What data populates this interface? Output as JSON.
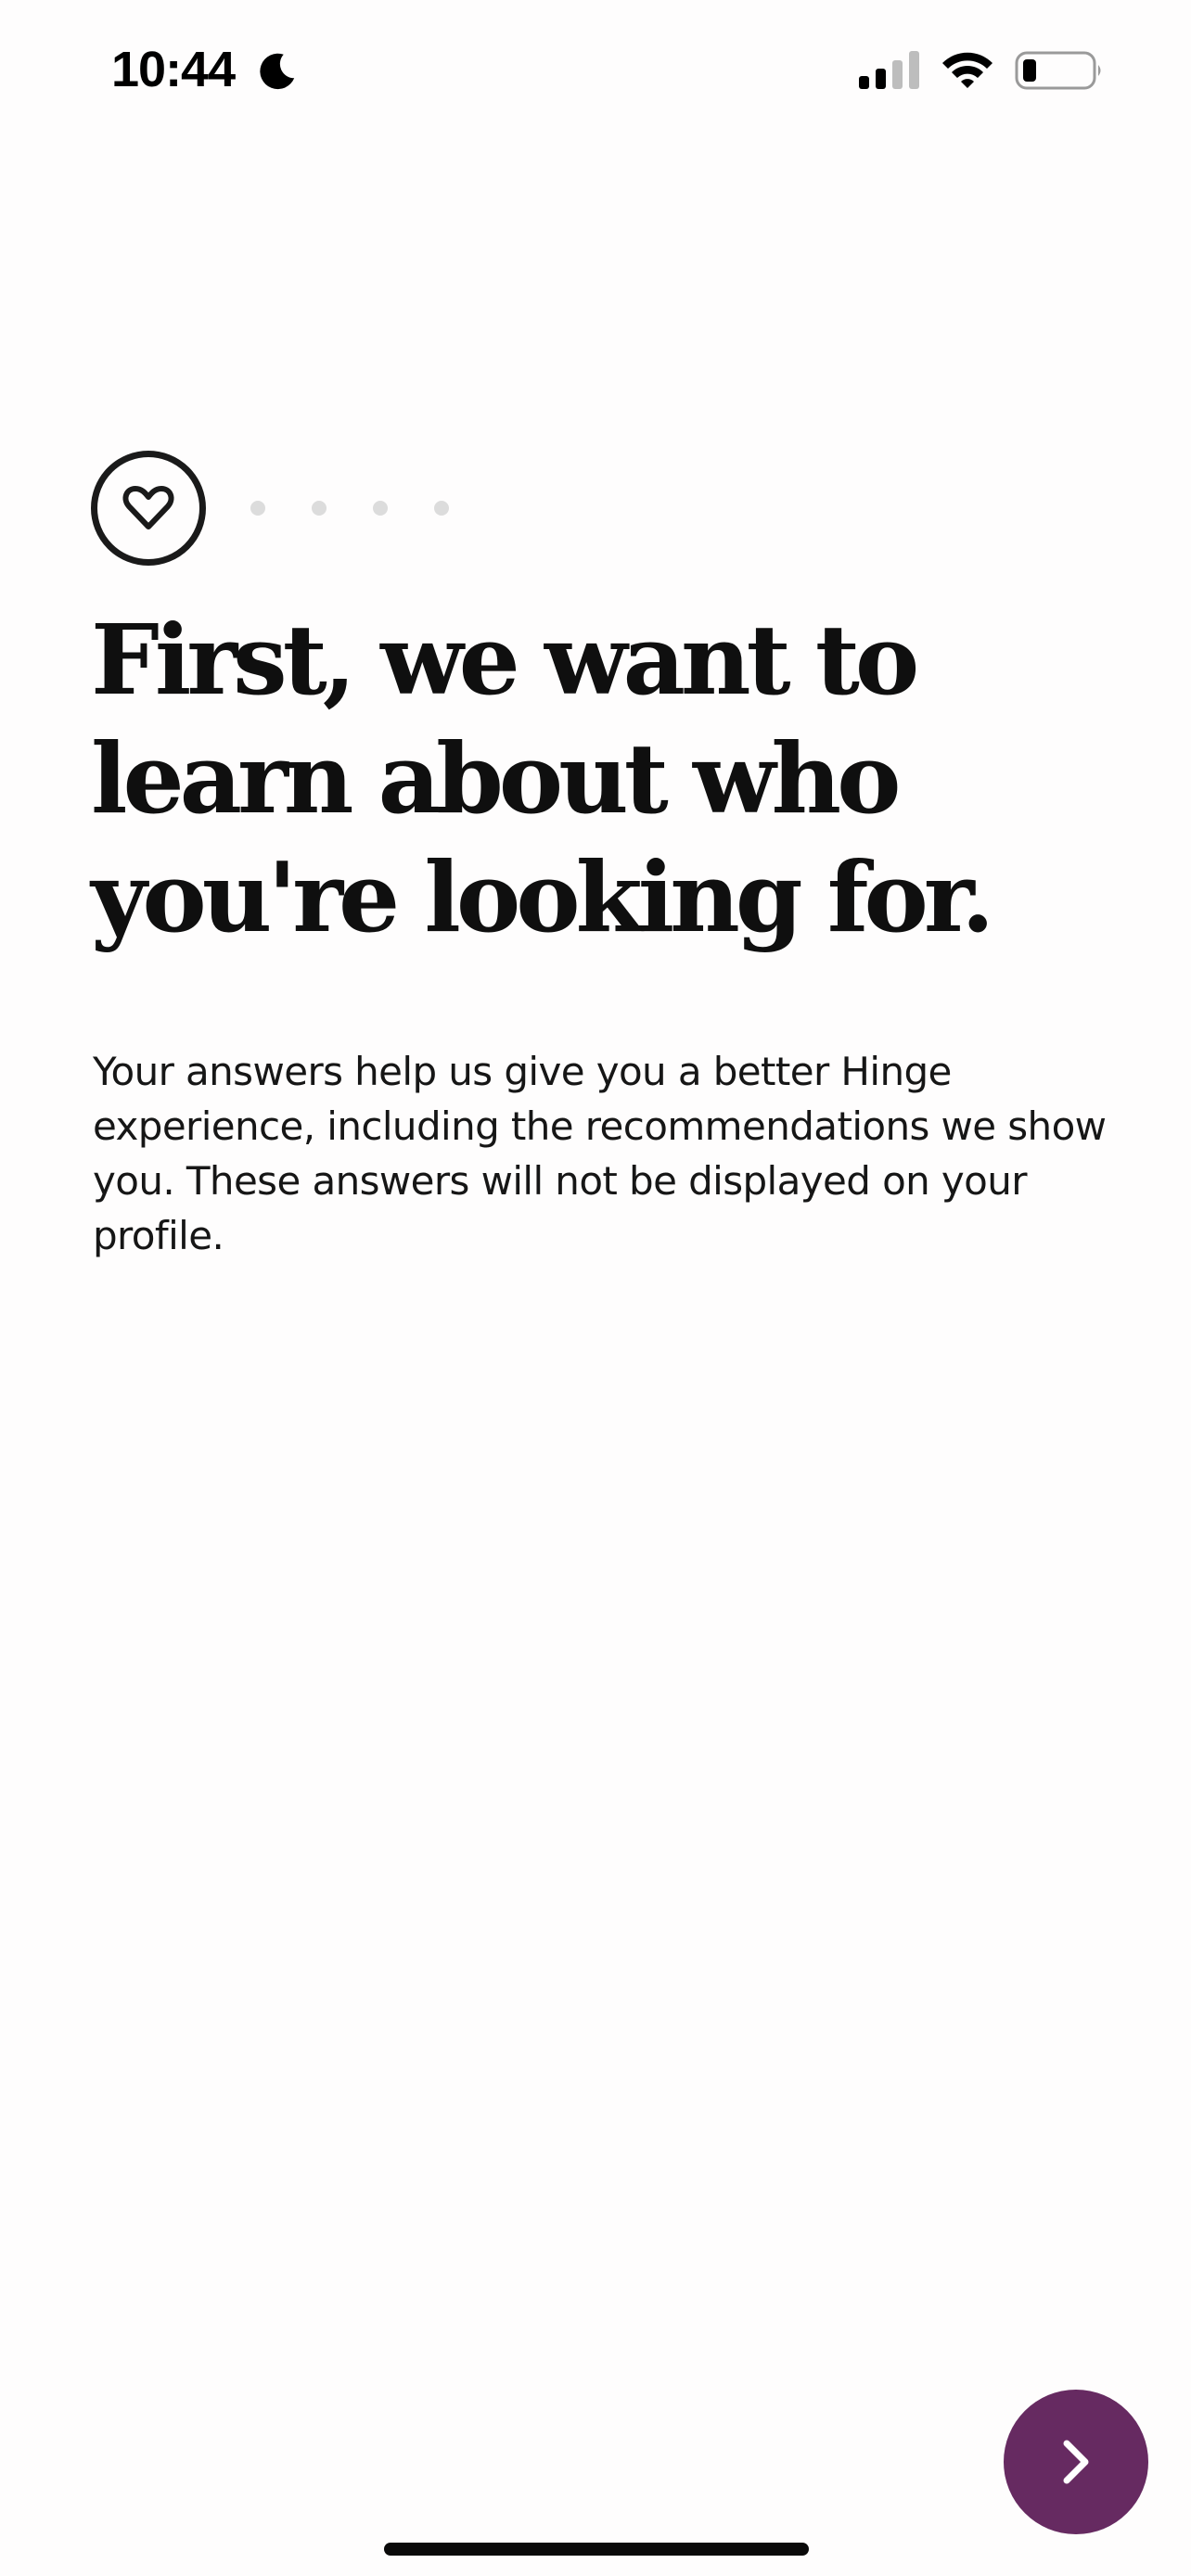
{
  "status_bar": {
    "time": "10:44",
    "icons": [
      "moon-icon",
      "signal-icon",
      "wifi-icon",
      "battery-icon"
    ]
  },
  "progress": {
    "current_icon": "heart-icon",
    "remaining_steps": 4
  },
  "main": {
    "headline": "First, we want to learn about who you're looking for.",
    "description": "Your answers help us give you a better Hinge experience, including the recommendations we show you. These answers will not be displayed on your profile."
  },
  "next_button": {
    "icon": "chevron-right-icon"
  },
  "colors": {
    "background": "#fefdfd",
    "accent": "#662a61",
    "text": "#111111",
    "inactive_dot": "#dcdcdc"
  }
}
